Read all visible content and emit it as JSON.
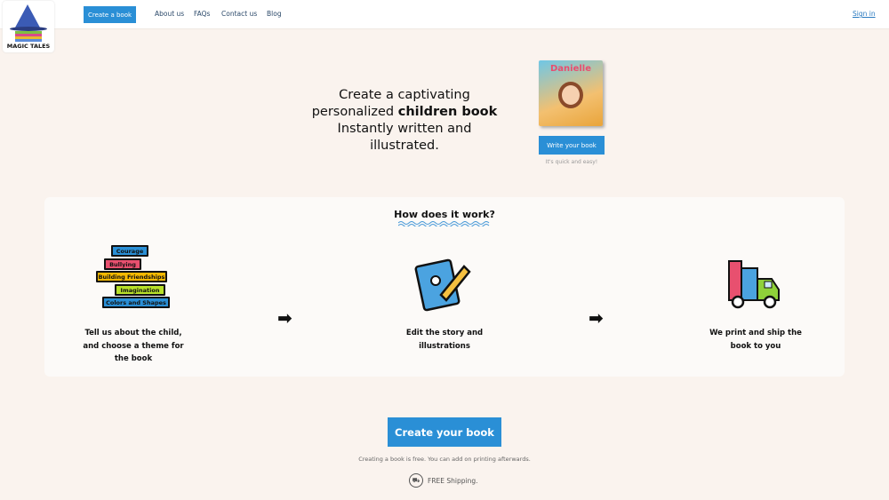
{
  "nav": {
    "logo_text": "MAGIC TALES",
    "create": "Create a book",
    "links": [
      "About us",
      "FAQs",
      "Contact us",
      "Blog"
    ],
    "signin": "Sign in"
  },
  "hero": {
    "line1": "Create a captivating",
    "line2a": "personalized ",
    "line2b": "children book",
    "line3": "Instantly written and illustrated.",
    "cover_name": "Danielle",
    "write": "Write your book",
    "quick": "It's quick and easy!"
  },
  "how": {
    "title": "How does it work?",
    "themes": [
      "Courage",
      "Bullying",
      "Building Friendships",
      "Imagination",
      "Colors and Shapes"
    ],
    "theme_colors": [
      "#2a8fd6",
      "#e8506f",
      "#f5b800",
      "#b8e02a",
      "#2a8fd6"
    ],
    "steps": [
      "Tell us about the child, and choose a theme for the book",
      "Edit the story and illustrations",
      "We print and ship the book to you"
    ]
  },
  "cta": {
    "label": "Create your book",
    "note": "Creating a book is free. You can add on printing afterwards.",
    "shipping": "FREE Shipping."
  },
  "colors": {
    "accent": "#2a8fd6",
    "background": "#faf3ee"
  }
}
